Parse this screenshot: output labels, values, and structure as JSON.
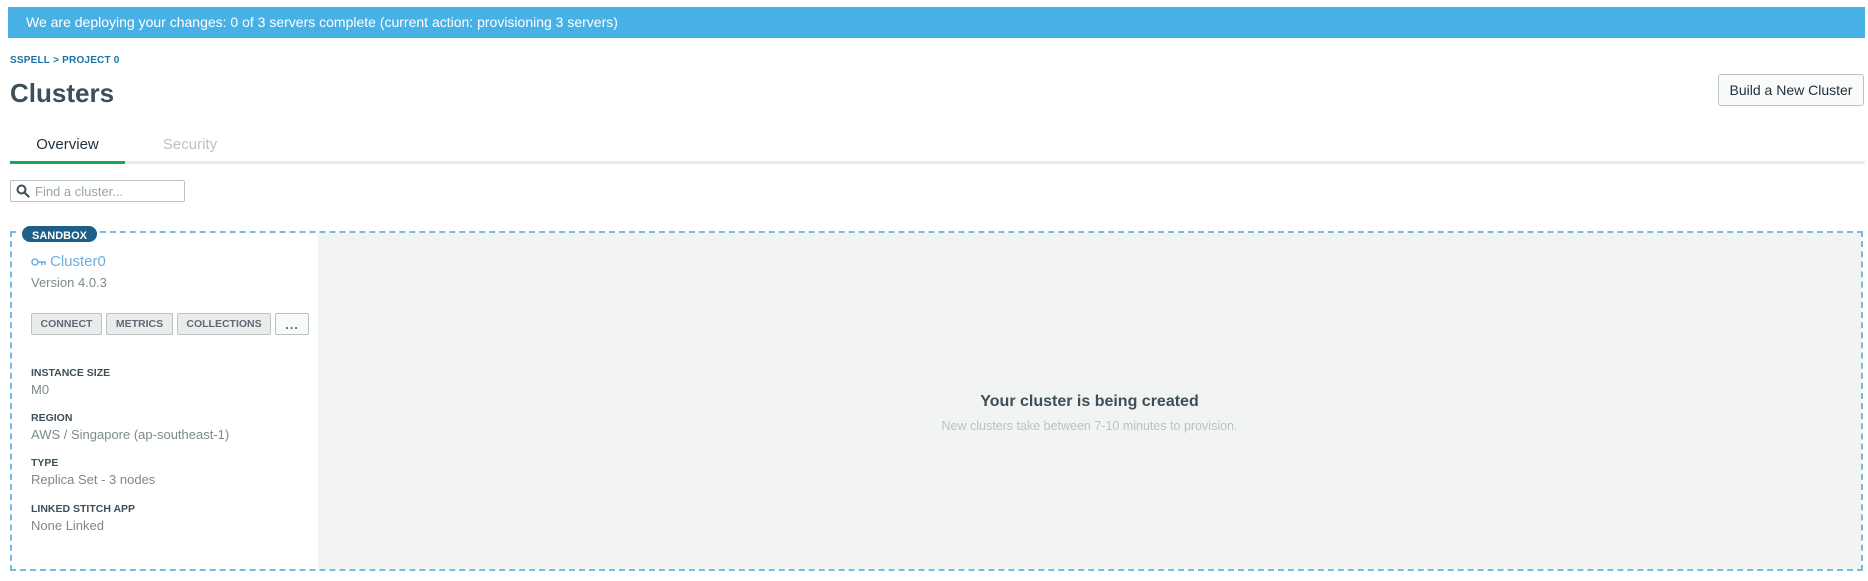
{
  "banner": {
    "message": "We are deploying your changes: 0 of 3 servers complete (current action: provisioning 3 servers)",
    "color": "#47b1e6"
  },
  "breadcrumb": {
    "org": "SSPELL",
    "separator": ">",
    "project": "PROJECT 0"
  },
  "page": {
    "title": "Clusters",
    "build_button": "Build a New Cluster"
  },
  "tabs": [
    {
      "label": "Overview",
      "active": true
    },
    {
      "label": "Security",
      "active": false
    }
  ],
  "search": {
    "placeholder": "Find a cluster...",
    "value": "",
    "icon": "search-icon"
  },
  "cluster": {
    "badge": "SANDBOX",
    "name": "Cluster0",
    "name_icon": "key-icon",
    "version": "Version 4.0.3",
    "actions": {
      "connect": "CONNECT",
      "metrics": "METRICS",
      "collections": "COLLECTIONS",
      "more": "..."
    },
    "properties": [
      {
        "label": "INSTANCE SIZE",
        "value": "M0"
      },
      {
        "label": "REGION",
        "value": "AWS / Singapore (ap-southeast-1)"
      },
      {
        "label": "TYPE",
        "value": "Replica Set - 3 nodes"
      },
      {
        "label": "LINKED STITCH APP",
        "value": "None Linked"
      }
    ],
    "status": {
      "title": "Your cluster is being created",
      "subtitle": "New clusters take between 7-10 minutes to provision."
    }
  },
  "colors": {
    "accent_green": "#13aa52",
    "link_blue": "#1a73a8",
    "badge_blue": "#1e5f8a",
    "card_border": "#77bce0"
  }
}
